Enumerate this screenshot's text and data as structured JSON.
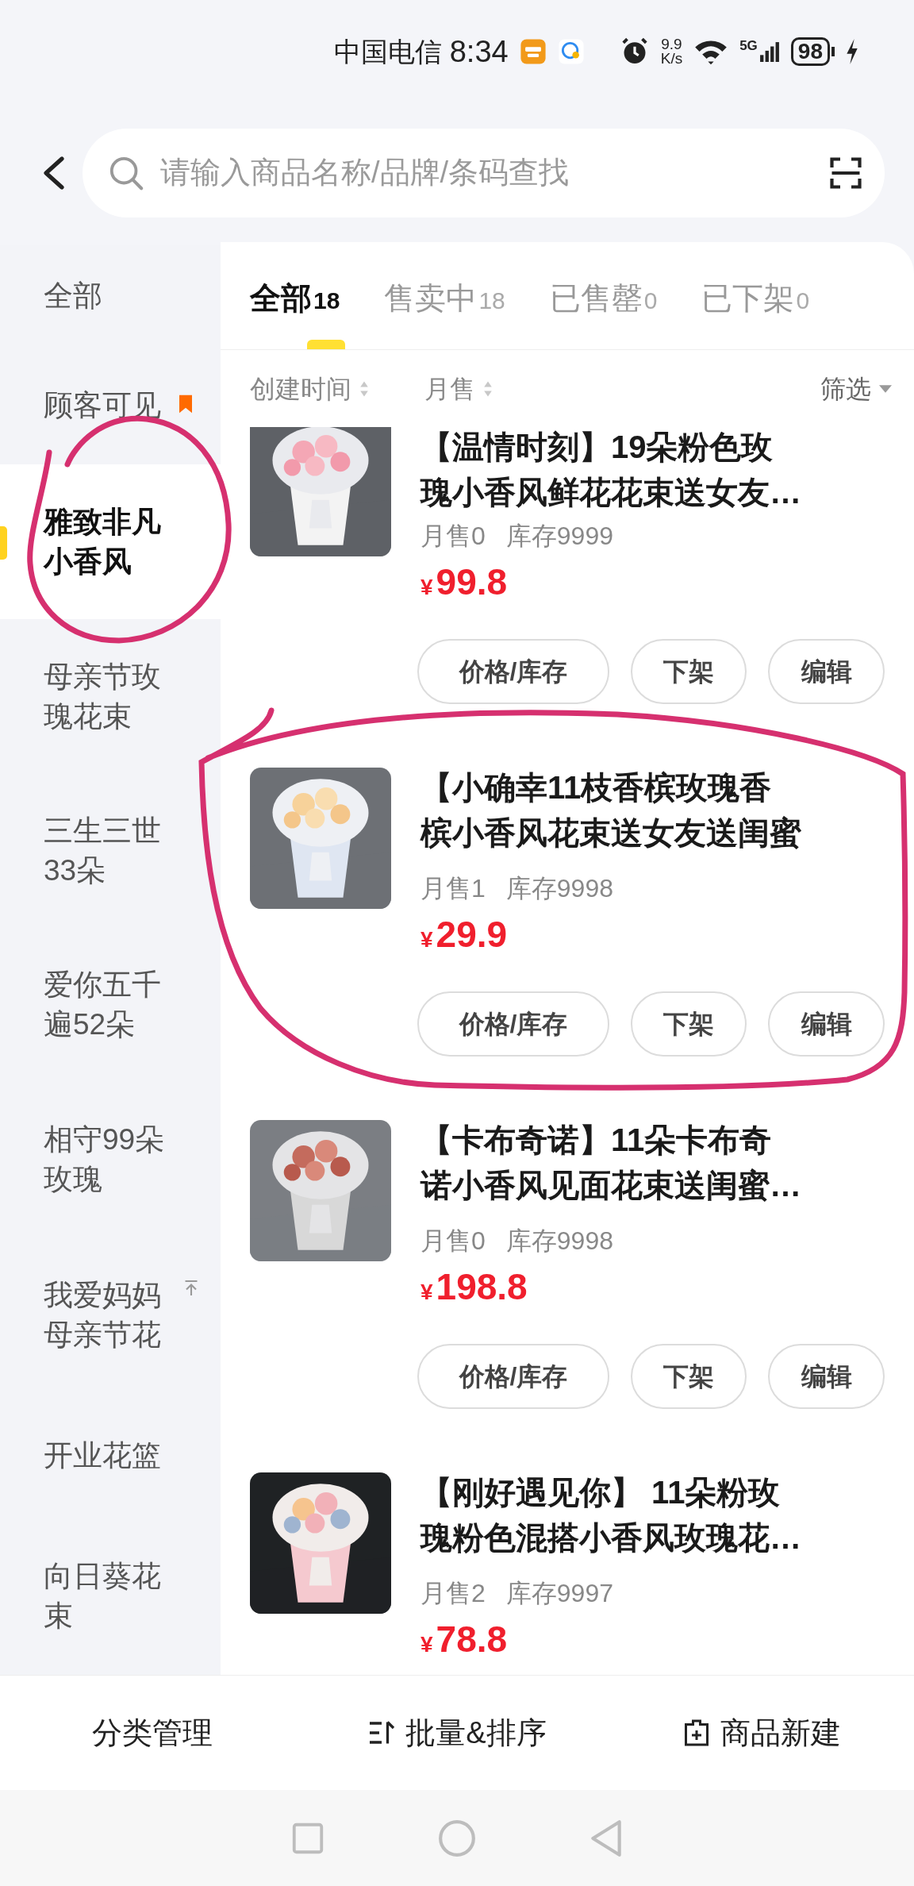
{
  "status_bar": {
    "carrier": "中国电信",
    "time": "8:34",
    "speed_value": "9.9",
    "speed_unit": "K/s",
    "network": "5G",
    "battery": "98",
    "charging": true
  },
  "search": {
    "placeholder": "请输入商品名称/品牌/条码查找"
  },
  "sidebar": {
    "items": [
      {
        "label": "全部",
        "selected": false
      },
      {
        "label": "顾客可见",
        "selected": false,
        "badge": true
      },
      {
        "label": "雅致非凡小香风",
        "selected": true
      },
      {
        "label": "母亲节玫瑰花束",
        "selected": false
      },
      {
        "label": "三生三世33朵",
        "selected": false
      },
      {
        "label": "爱你五千遍52朵",
        "selected": false
      },
      {
        "label": "相守99朵玫瑰",
        "selected": false
      },
      {
        "label": "我爱妈妈母亲节花",
        "selected": false,
        "pinned": true
      },
      {
        "label": "开业花篮",
        "selected": false
      },
      {
        "label": "向日葵花束",
        "selected": false
      }
    ]
  },
  "tabs": [
    {
      "label": "全部",
      "count": "18",
      "selected": true
    },
    {
      "label": "售卖中",
      "count": "18",
      "selected": false
    },
    {
      "label": "已售罄",
      "count": "0",
      "selected": false
    },
    {
      "label": "已下架",
      "count": "0",
      "selected": false
    }
  ],
  "sort_bar": {
    "items": [
      {
        "label": "创建时间",
        "kind": "sort"
      },
      {
        "label": "月售",
        "kind": "sort"
      },
      {
        "label": "筛选",
        "kind": "filter"
      }
    ]
  },
  "products": [
    {
      "title_lines": [
        "【温情时刻】19朵粉色玫",
        "瑰小香风鲜花花束送女友…"
      ],
      "sales": "月售0",
      "stock": "库存9999",
      "currency": "¥",
      "price": "99.8",
      "image": {
        "kind": "picture"
      },
      "actions": [
        "价格/库存",
        "下架",
        "编辑"
      ]
    },
    {
      "title_lines": [
        "【小确幸11枝香槟玫瑰香",
        "槟小香风花束送女友送闺蜜"
      ],
      "sales": "月售1",
      "stock": "库存9998",
      "currency": "¥",
      "price": "29.9",
      "image": {
        "kind": "picture"
      },
      "actions": [
        "价格/库存",
        "下架",
        "编辑"
      ]
    },
    {
      "title_lines": [
        "【卡布奇诺】11朵卡布奇",
        "诺小香风见面花束送闺蜜…"
      ],
      "sales": "月售0",
      "stock": "库存9998",
      "currency": "¥",
      "price": "198.8",
      "image": {
        "kind": "picture"
      },
      "actions": [
        "价格/库存",
        "下架",
        "编辑"
      ]
    },
    {
      "title_lines": [
        "【刚好遇见你】 11朵粉玫",
        "瑰粉色混搭小香风玫瑰花…"
      ],
      "sales": "月售2",
      "stock": "库存9997",
      "currency": "¥",
      "price": "78.8",
      "image": {
        "kind": "picture"
      }
    }
  ],
  "bottom_bar": [
    {
      "label": "分类管理",
      "kind": "plain"
    },
    {
      "label": "批量&排序",
      "kind": "batch"
    },
    {
      "label": "商品新建",
      "kind": "new"
    }
  ]
}
